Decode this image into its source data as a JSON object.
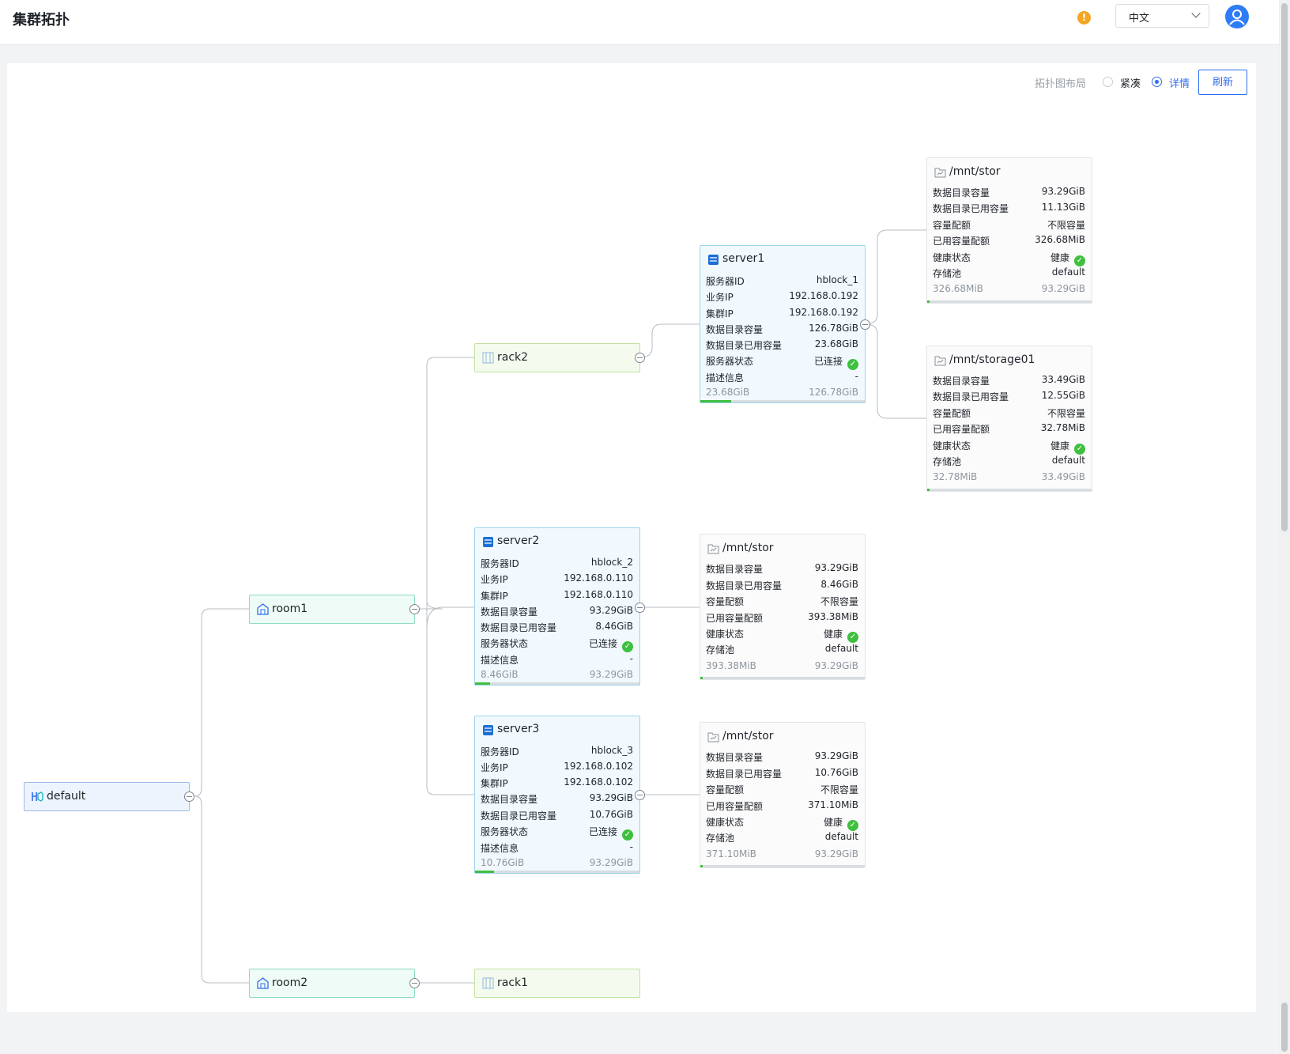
{
  "header": {
    "title": "集群拓扑",
    "language": "中文"
  },
  "toolbar": {
    "layout_label": "拓扑图布局",
    "compact_label": "紧凑",
    "detail_label": "详情",
    "refresh_label": "刷新",
    "selected_layout": "详情"
  },
  "labels": {
    "server_id": "服务器ID",
    "biz_ip": "业务IP",
    "cluster_ip": "集群IP",
    "data_cap": "数据目录容量",
    "data_used": "数据目录已用容量",
    "server_status": "服务器状态",
    "desc": "描述信息",
    "quota": "容量配额",
    "used_quota": "已用容量配额",
    "health": "健康状态",
    "pool": "存储池"
  },
  "tree": {
    "root": {
      "name": "default"
    },
    "room1": {
      "name": "room1"
    },
    "room2": {
      "name": "room2"
    },
    "rack1": {
      "name": "rack1"
    },
    "rack2": {
      "name": "rack2"
    },
    "servers": [
      {
        "name": "server1",
        "id": "hblock_1",
        "biz_ip": "192.168.0.192",
        "cluster_ip": "192.168.0.192",
        "data_cap": "126.78GiB",
        "data_used": "23.68GiB",
        "status": "已连接",
        "desc": "-",
        "foot_used": "23.68GiB",
        "foot_total": "126.78GiB",
        "usage_ratio": 0.187
      },
      {
        "name": "server2",
        "id": "hblock_2",
        "biz_ip": "192.168.0.110",
        "cluster_ip": "192.168.0.110",
        "data_cap": "93.29GiB",
        "data_used": "8.46GiB",
        "status": "已连接",
        "desc": "-",
        "foot_used": "8.46GiB",
        "foot_total": "93.29GiB",
        "usage_ratio": 0.091
      },
      {
        "name": "server3",
        "id": "hblock_3",
        "biz_ip": "192.168.0.102",
        "cluster_ip": "192.168.0.102",
        "data_cap": "93.29GiB",
        "data_used": "10.76GiB",
        "status": "已连接",
        "desc": "-",
        "foot_used": "10.76GiB",
        "foot_total": "93.29GiB",
        "usage_ratio": 0.115
      }
    ],
    "storages": [
      {
        "path": "/mnt/stor",
        "data_cap": "93.29GiB",
        "data_used": "11.13GiB",
        "quota": "不限容量",
        "used_quota": "326.68MiB",
        "health": "健康",
        "pool": "default",
        "foot_used": "326.68MiB",
        "foot_total": "93.29GiB",
        "usage_ratio": 0.0034
      },
      {
        "path": "/mnt/storage01",
        "data_cap": "33.49GiB",
        "data_used": "12.55GiB",
        "quota": "不限容量",
        "used_quota": "32.78MiB",
        "health": "健康",
        "pool": "default",
        "foot_used": "32.78MiB",
        "foot_total": "33.49GiB",
        "usage_ratio": 0.001
      },
      {
        "path": "/mnt/stor",
        "data_cap": "93.29GiB",
        "data_used": "8.46GiB",
        "quota": "不限容量",
        "used_quota": "393.38MiB",
        "health": "健康",
        "pool": "default",
        "foot_used": "393.38MiB",
        "foot_total": "93.29GiB",
        "usage_ratio": 0.0041
      },
      {
        "path": "/mnt/stor",
        "data_cap": "93.29GiB",
        "data_used": "10.76GiB",
        "quota": "不限容量",
        "used_quota": "371.10MiB",
        "health": "健康",
        "pool": "default",
        "foot_used": "371.10MiB",
        "foot_total": "93.29GiB",
        "usage_ratio": 0.0039
      }
    ]
  }
}
